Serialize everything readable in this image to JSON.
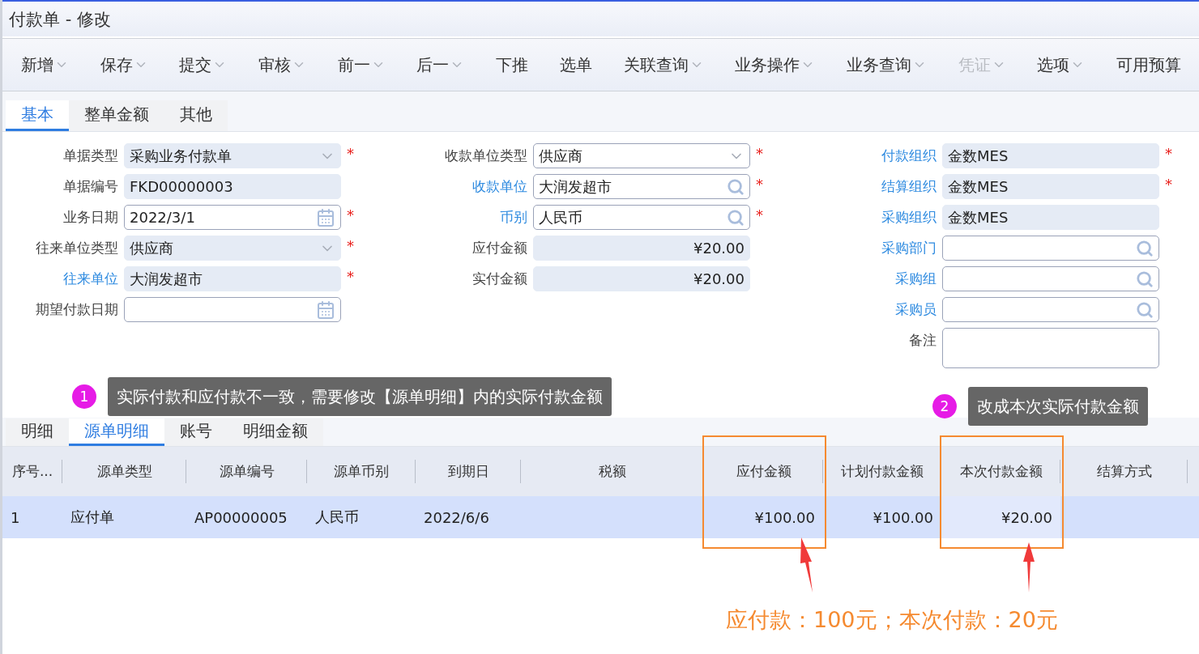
{
  "window": {
    "title": "付款单 - 修改"
  },
  "toolbar": [
    {
      "label": "新增",
      "dropdown": true,
      "disabled": false
    },
    {
      "label": "保存",
      "dropdown": true,
      "disabled": false
    },
    {
      "label": "提交",
      "dropdown": true,
      "disabled": false
    },
    {
      "label": "审核",
      "dropdown": true,
      "disabled": false
    },
    {
      "label": "前一",
      "dropdown": true,
      "disabled": false
    },
    {
      "label": "后一",
      "dropdown": true,
      "disabled": false
    },
    {
      "label": "下推",
      "dropdown": false,
      "disabled": false
    },
    {
      "label": "选单",
      "dropdown": false,
      "disabled": false
    },
    {
      "label": "关联查询",
      "dropdown": true,
      "disabled": false
    },
    {
      "label": "业务操作",
      "dropdown": true,
      "disabled": false
    },
    {
      "label": "业务查询",
      "dropdown": true,
      "disabled": false
    },
    {
      "label": "凭证",
      "dropdown": true,
      "disabled": true
    },
    {
      "label": "选项",
      "dropdown": true,
      "disabled": false
    },
    {
      "label": "可用预算",
      "dropdown": false,
      "disabled": false
    }
  ],
  "tabs": [
    {
      "label": "基本",
      "selected": true
    },
    {
      "label": "整单金额",
      "selected": false
    },
    {
      "label": "其他",
      "selected": false
    }
  ],
  "form": {
    "columns": [
      [
        {
          "label": "单据类型",
          "kind": "select",
          "value": "采购业务付款单",
          "readonly": true,
          "required_mark": "*",
          "link": false
        },
        {
          "label": "单据编号",
          "kind": "text",
          "value": "FKD00000003",
          "readonly": true,
          "link": false
        },
        {
          "label": "业务日期",
          "kind": "date",
          "value": "2022/3/1",
          "readonly": false,
          "required_mark": "*",
          "link": false
        },
        {
          "label": "往来单位类型",
          "kind": "select",
          "value": "供应商",
          "readonly": true,
          "required_mark": "*",
          "link": false
        },
        {
          "label": "往来单位",
          "kind": "text",
          "value": "大润发超市",
          "readonly": true,
          "required_mark": "*",
          "link": true
        },
        {
          "label": "期望付款日期",
          "kind": "date",
          "readonly": false,
          "link": false
        }
      ],
      [
        {
          "label": "收款单位类型",
          "kind": "select",
          "value": "供应商",
          "readonly": false,
          "required_mark": "*",
          "link": false
        },
        {
          "label": "收款单位",
          "kind": "lookup",
          "value": "大润发超市",
          "readonly": false,
          "required_mark": "*",
          "link": true
        },
        {
          "label": "币别",
          "kind": "lookup",
          "value": "人民币",
          "readonly": false,
          "required_mark": "*",
          "link": true
        },
        {
          "label": "应付金额",
          "kind": "amount",
          "value": "¥20.00",
          "readonly": true,
          "link": false
        },
        {
          "label": "实付金额",
          "kind": "amount",
          "value": "¥20.00",
          "readonly": true,
          "link": false
        }
      ],
      [
        {
          "label": "付款组织",
          "kind": "text",
          "value": "金数MES",
          "readonly": true,
          "required_mark": "*",
          "link": true
        },
        {
          "label": "结算组织",
          "kind": "text",
          "value": "金数MES",
          "readonly": true,
          "required_mark": "*",
          "link": true
        },
        {
          "label": "采购组织",
          "kind": "text",
          "value": "金数MES",
          "readonly": true,
          "link": true
        },
        {
          "label": "采购部门",
          "kind": "lookup",
          "readonly": false,
          "link": true
        },
        {
          "label": "采购组",
          "kind": "lookup",
          "readonly": false,
          "link": true
        },
        {
          "label": "采购员",
          "kind": "lookup",
          "readonly": false,
          "link": true
        },
        {
          "label": "备注",
          "kind": "textarea",
          "readonly": false,
          "link": false
        }
      ]
    ]
  },
  "detail_tabs": [
    {
      "label": "明细",
      "selected": false
    },
    {
      "label": "源单明细",
      "selected": true
    },
    {
      "label": "账号",
      "selected": false
    },
    {
      "label": "明细金额",
      "selected": false
    }
  ],
  "table": {
    "columns": [
      {
        "label": "序号...",
        "kind": "text",
        "highlighted": false
      },
      {
        "label": "源单类型",
        "kind": "text",
        "highlighted": false
      },
      {
        "label": "源单编号",
        "kind": "text",
        "highlighted": false
      },
      {
        "label": "源单币别",
        "kind": "text",
        "highlighted": false
      },
      {
        "label": "到期日",
        "kind": "text",
        "highlighted": false
      },
      {
        "label": "税额",
        "kind": "amount",
        "highlighted": false
      },
      {
        "label": "应付金额",
        "kind": "amount",
        "highlighted": true
      },
      {
        "label": "计划付款金额",
        "kind": "amount",
        "highlighted": false
      },
      {
        "label": "本次付款金额",
        "kind": "amount",
        "highlighted": true
      },
      {
        "label": "结算方式",
        "kind": "text",
        "highlighted": false
      }
    ],
    "rows": [
      {
        "selected": true,
        "cells": [
          {
            "text": "1",
            "focused": false
          },
          {
            "text": "应付单",
            "focused": false
          },
          {
            "text": "AP00000005",
            "focused": false
          },
          {
            "text": "人民币",
            "focused": false
          },
          {
            "text": "2022/6/6",
            "focused": false
          },
          {
            "focused": false
          },
          {
            "text": "¥100.00",
            "focused": false
          },
          {
            "text": "¥100.00",
            "focused": false
          },
          {
            "text": "¥20.00",
            "focused": true
          },
          {
            "focused": false
          }
        ]
      }
    ]
  },
  "annotations": {
    "callouts": [
      {
        "number": "1",
        "text": "实际付款和应付款不一致，需要修改【源单明细】内的实际付款金额"
      },
      {
        "number": "2",
        "text": "改成本次实际付款金额"
      }
    ],
    "note": "应付款：100元；本次付款：20元"
  }
}
